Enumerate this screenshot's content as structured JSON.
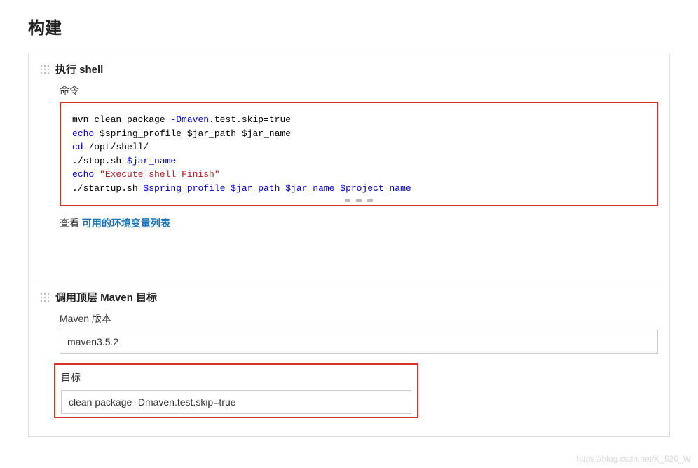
{
  "section_title": "构建",
  "steps": {
    "shell": {
      "title": "执行 shell",
      "command_label": "命令",
      "code": {
        "line1_a": "mvn clean package ",
        "line1_b": "-Dmaven",
        "line1_c": ".test.skip=true",
        "line2_a": "echo",
        "line2_b": " $spring_profile $jar_path $jar_name",
        "line3_a": "cd",
        "line3_b": " /opt/shell/",
        "line4_a": "./stop.sh",
        "line4_b": " $jar_name",
        "line5_a": "echo",
        "line5_b": " \"Execute shell Finish\"",
        "line6_a": "./startup.sh",
        "line6_b": " $spring_profile $jar_path $jar_name $project_name"
      },
      "view_prefix": "查看 ",
      "view_link": "可用的环境变量列表"
    },
    "maven": {
      "title": "调用顶层 Maven 目标",
      "version_label": "Maven 版本",
      "version_value": "maven3.5.2",
      "goal_label": "目标",
      "goal_value": "clean package -Dmaven.test.skip=true"
    }
  },
  "watermark": "https://blog.csdn.net/K_520_W"
}
